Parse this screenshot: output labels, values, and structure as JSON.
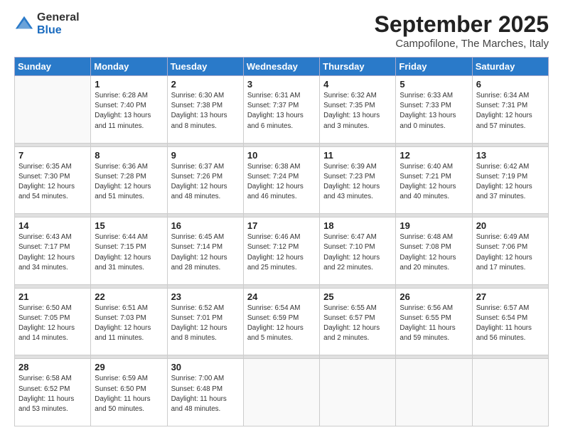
{
  "logo": {
    "general": "General",
    "blue": "Blue"
  },
  "title": {
    "main": "September 2025",
    "sub": "Campofilone, The Marches, Italy"
  },
  "calendar": {
    "headers": [
      "Sunday",
      "Monday",
      "Tuesday",
      "Wednesday",
      "Thursday",
      "Friday",
      "Saturday"
    ],
    "rows": [
      [
        {
          "num": "",
          "sunrise": "",
          "sunset": "",
          "daylight": ""
        },
        {
          "num": "1",
          "sunrise": "Sunrise: 6:28 AM",
          "sunset": "Sunset: 7:40 PM",
          "daylight": "Daylight: 13 hours and 11 minutes."
        },
        {
          "num": "2",
          "sunrise": "Sunrise: 6:30 AM",
          "sunset": "Sunset: 7:38 PM",
          "daylight": "Daylight: 13 hours and 8 minutes."
        },
        {
          "num": "3",
          "sunrise": "Sunrise: 6:31 AM",
          "sunset": "Sunset: 7:37 PM",
          "daylight": "Daylight: 13 hours and 6 minutes."
        },
        {
          "num": "4",
          "sunrise": "Sunrise: 6:32 AM",
          "sunset": "Sunset: 7:35 PM",
          "daylight": "Daylight: 13 hours and 3 minutes."
        },
        {
          "num": "5",
          "sunrise": "Sunrise: 6:33 AM",
          "sunset": "Sunset: 7:33 PM",
          "daylight": "Daylight: 13 hours and 0 minutes."
        },
        {
          "num": "6",
          "sunrise": "Sunrise: 6:34 AM",
          "sunset": "Sunset: 7:31 PM",
          "daylight": "Daylight: 12 hours and 57 minutes."
        }
      ],
      [
        {
          "num": "7",
          "sunrise": "Sunrise: 6:35 AM",
          "sunset": "Sunset: 7:30 PM",
          "daylight": "Daylight: 12 hours and 54 minutes."
        },
        {
          "num": "8",
          "sunrise": "Sunrise: 6:36 AM",
          "sunset": "Sunset: 7:28 PM",
          "daylight": "Daylight: 12 hours and 51 minutes."
        },
        {
          "num": "9",
          "sunrise": "Sunrise: 6:37 AM",
          "sunset": "Sunset: 7:26 PM",
          "daylight": "Daylight: 12 hours and 48 minutes."
        },
        {
          "num": "10",
          "sunrise": "Sunrise: 6:38 AM",
          "sunset": "Sunset: 7:24 PM",
          "daylight": "Daylight: 12 hours and 46 minutes."
        },
        {
          "num": "11",
          "sunrise": "Sunrise: 6:39 AM",
          "sunset": "Sunset: 7:23 PM",
          "daylight": "Daylight: 12 hours and 43 minutes."
        },
        {
          "num": "12",
          "sunrise": "Sunrise: 6:40 AM",
          "sunset": "Sunset: 7:21 PM",
          "daylight": "Daylight: 12 hours and 40 minutes."
        },
        {
          "num": "13",
          "sunrise": "Sunrise: 6:42 AM",
          "sunset": "Sunset: 7:19 PM",
          "daylight": "Daylight: 12 hours and 37 minutes."
        }
      ],
      [
        {
          "num": "14",
          "sunrise": "Sunrise: 6:43 AM",
          "sunset": "Sunset: 7:17 PM",
          "daylight": "Daylight: 12 hours and 34 minutes."
        },
        {
          "num": "15",
          "sunrise": "Sunrise: 6:44 AM",
          "sunset": "Sunset: 7:15 PM",
          "daylight": "Daylight: 12 hours and 31 minutes."
        },
        {
          "num": "16",
          "sunrise": "Sunrise: 6:45 AM",
          "sunset": "Sunset: 7:14 PM",
          "daylight": "Daylight: 12 hours and 28 minutes."
        },
        {
          "num": "17",
          "sunrise": "Sunrise: 6:46 AM",
          "sunset": "Sunset: 7:12 PM",
          "daylight": "Daylight: 12 hours and 25 minutes."
        },
        {
          "num": "18",
          "sunrise": "Sunrise: 6:47 AM",
          "sunset": "Sunset: 7:10 PM",
          "daylight": "Daylight: 12 hours and 22 minutes."
        },
        {
          "num": "19",
          "sunrise": "Sunrise: 6:48 AM",
          "sunset": "Sunset: 7:08 PM",
          "daylight": "Daylight: 12 hours and 20 minutes."
        },
        {
          "num": "20",
          "sunrise": "Sunrise: 6:49 AM",
          "sunset": "Sunset: 7:06 PM",
          "daylight": "Daylight: 12 hours and 17 minutes."
        }
      ],
      [
        {
          "num": "21",
          "sunrise": "Sunrise: 6:50 AM",
          "sunset": "Sunset: 7:05 PM",
          "daylight": "Daylight: 12 hours and 14 minutes."
        },
        {
          "num": "22",
          "sunrise": "Sunrise: 6:51 AM",
          "sunset": "Sunset: 7:03 PM",
          "daylight": "Daylight: 12 hours and 11 minutes."
        },
        {
          "num": "23",
          "sunrise": "Sunrise: 6:52 AM",
          "sunset": "Sunset: 7:01 PM",
          "daylight": "Daylight: 12 hours and 8 minutes."
        },
        {
          "num": "24",
          "sunrise": "Sunrise: 6:54 AM",
          "sunset": "Sunset: 6:59 PM",
          "daylight": "Daylight: 12 hours and 5 minutes."
        },
        {
          "num": "25",
          "sunrise": "Sunrise: 6:55 AM",
          "sunset": "Sunset: 6:57 PM",
          "daylight": "Daylight: 12 hours and 2 minutes."
        },
        {
          "num": "26",
          "sunrise": "Sunrise: 6:56 AM",
          "sunset": "Sunset: 6:55 PM",
          "daylight": "Daylight: 11 hours and 59 minutes."
        },
        {
          "num": "27",
          "sunrise": "Sunrise: 6:57 AM",
          "sunset": "Sunset: 6:54 PM",
          "daylight": "Daylight: 11 hours and 56 minutes."
        }
      ],
      [
        {
          "num": "28",
          "sunrise": "Sunrise: 6:58 AM",
          "sunset": "Sunset: 6:52 PM",
          "daylight": "Daylight: 11 hours and 53 minutes."
        },
        {
          "num": "29",
          "sunrise": "Sunrise: 6:59 AM",
          "sunset": "Sunset: 6:50 PM",
          "daylight": "Daylight: 11 hours and 50 minutes."
        },
        {
          "num": "30",
          "sunrise": "Sunrise: 7:00 AM",
          "sunset": "Sunset: 6:48 PM",
          "daylight": "Daylight: 11 hours and 48 minutes."
        },
        {
          "num": "",
          "sunrise": "",
          "sunset": "",
          "daylight": ""
        },
        {
          "num": "",
          "sunrise": "",
          "sunset": "",
          "daylight": ""
        },
        {
          "num": "",
          "sunrise": "",
          "sunset": "",
          "daylight": ""
        },
        {
          "num": "",
          "sunrise": "",
          "sunset": "",
          "daylight": ""
        }
      ]
    ]
  }
}
